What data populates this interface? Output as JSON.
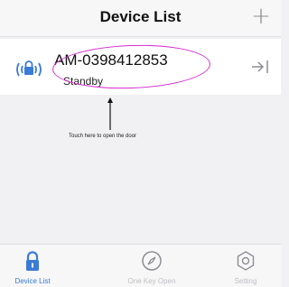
{
  "header": {
    "title": "Device List",
    "add_symbol": "+"
  },
  "device": {
    "name": "AM-0398412853",
    "status": "Standby"
  },
  "hint_text": "Touch here to open the door",
  "tabs": [
    {
      "label": "Device List",
      "icon": "lock-icon",
      "active": true
    },
    {
      "label": "One Key Open",
      "icon": "key-compass-icon",
      "active": false
    },
    {
      "label": "Setting",
      "icon": "gear-icon",
      "active": false
    }
  ],
  "colors": {
    "accent": "#3a7bd5",
    "annotation": "#d42bd0",
    "inactive": "#c0c0c4"
  }
}
